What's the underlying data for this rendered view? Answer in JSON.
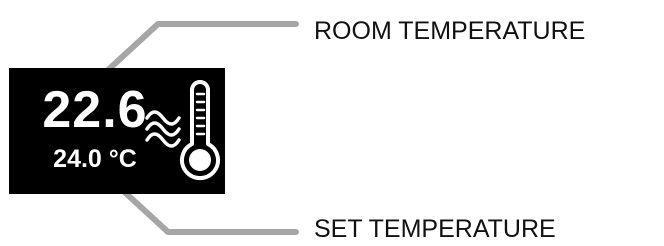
{
  "display": {
    "room_temperature": "22.6",
    "set_temperature": "24.0 °C",
    "background_color": "#000000",
    "text_color": "#ffffff"
  },
  "callouts": {
    "room_label": "ROOM TEMPERATURE",
    "set_label": "SET TEMPERATURE",
    "line_color": "#a6a6a6"
  },
  "icons": {
    "heat": "heat-waves-icon",
    "thermometer": "thermometer-icon"
  }
}
